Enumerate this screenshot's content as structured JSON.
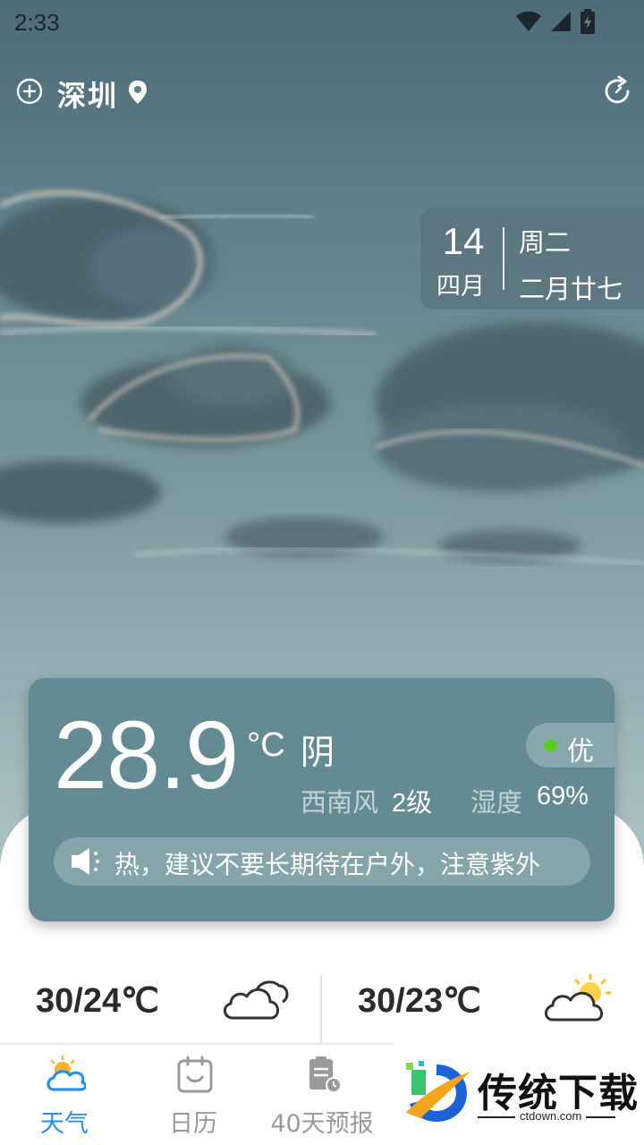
{
  "status_bar": {
    "time": "2:33",
    "icons": [
      "wifi-icon",
      "signal-icon",
      "battery-charging-icon"
    ]
  },
  "header": {
    "city": "深圳",
    "add_city_icon": "plus-circle-icon",
    "location_icon": "location-pin-icon",
    "refresh_icon": "refresh-icon"
  },
  "date_card": {
    "day": "14",
    "month": "四月",
    "weekday": "周二",
    "lunar_date": "二月廿七"
  },
  "current": {
    "temperature": "28.9",
    "unit": "°C",
    "condition": "阴",
    "aqi_label": "优",
    "aqi_color": "#5ec82a",
    "wind_direction": "西南风",
    "wind_level": "2级",
    "humidity_label": "湿度",
    "humidity_value": "69%",
    "tip": "热，建议不要长期待在户外，注意紫外"
  },
  "forecast": [
    {
      "temp_range": "30/24℃",
      "icon": "cloudy-icon"
    },
    {
      "temp_range": "30/23℃",
      "icon": "partly-cloudy-sun-icon"
    }
  ],
  "nav": {
    "items": [
      {
        "label": "天气",
        "icon": "weather-icon",
        "active": true
      },
      {
        "label": "日历",
        "icon": "calendar-icon",
        "active": false
      },
      {
        "label": "40天预报",
        "icon": "forecast-clipboard-icon",
        "active": false
      }
    ],
    "active_color": "#2a8fe0",
    "inactive_color": "#9a9a9a"
  },
  "watermark": {
    "title": "传统下载",
    "url": "ctdown.com"
  }
}
